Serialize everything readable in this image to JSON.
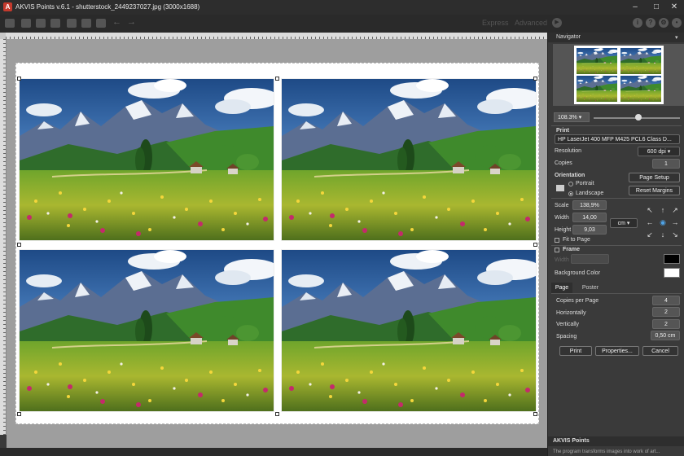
{
  "window": {
    "title": "AKVIS Points v.6.1 - shutterstock_2449237027.jpg (3000x1688)",
    "app_icon_letter": "A",
    "controls": [
      "–",
      "□",
      "✕"
    ]
  },
  "toolbar": {
    "express_label": "Express",
    "advanced_label": "Advanced",
    "undo_glyph": "←",
    "redo_glyph": "→",
    "info_glyph": "i",
    "help_glyph": "?",
    "settings_glyph": "⚙",
    "run_glyph": "▶",
    "bell_glyph": "•"
  },
  "navigator": {
    "title": "Navigator",
    "zoom": "108.3%"
  },
  "print": {
    "section_label": "Print",
    "printer": "HP LaserJet 400 MFP M425 PCL6 Class D...",
    "resolution_label": "Resolution",
    "resolution": "600 dpi",
    "copies_label": "Copies",
    "copies": "1",
    "orientation_label": "Orientation",
    "portrait_label": "Portrait",
    "landscape_label": "Landscape",
    "page_setup_label": "Page Setup",
    "reset_margins_label": "Reset Margins",
    "scale_label": "Scale",
    "scale": "138,9%",
    "width_label": "Width",
    "width": "14,00",
    "height_label": "Height",
    "height": "9,03",
    "unit": "cm",
    "fit_to_page_label": "Fit to Page",
    "frame_label": "Frame",
    "frame_width_label": "Width",
    "background_color_label": "Background Color",
    "frame_color": "#000000",
    "background_color": "#ffffff"
  },
  "tabs": {
    "page_label": "Page",
    "poster_label": "Poster"
  },
  "page_settings": {
    "copies_per_page_label": "Copies per Page",
    "copies_per_page": "4",
    "horizontally_label": "Horizontally",
    "horizontally": "2",
    "vertically_label": "Vertically",
    "vertically": "2",
    "spacing_label": "Spacing",
    "spacing": "0,50 cm"
  },
  "actions": {
    "print_label": "Print",
    "properties_label": "Properties...",
    "cancel_label": "Cancel"
  },
  "about": {
    "title": "AKVIS Points",
    "text": "The program transforms images into work of art..."
  }
}
